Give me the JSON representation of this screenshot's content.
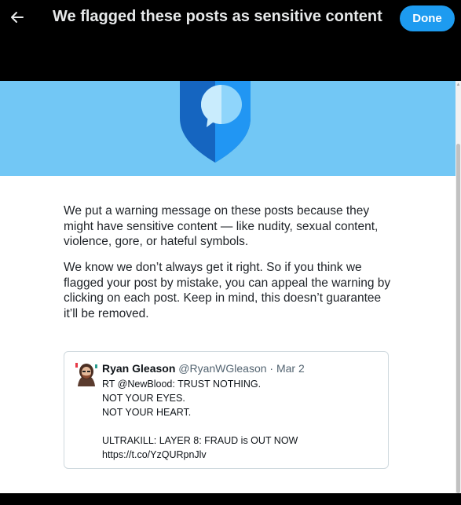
{
  "header": {
    "title": "We flagged these posts as sensitive content",
    "done_label": "Done",
    "back_icon": "arrow-left-icon"
  },
  "banner": {
    "background": "#72c7f5",
    "icon": "shield-chat-icon"
  },
  "explanation": {
    "paragraph1": "We put a warning message on these posts because they might have sensitive content — like nudity, sexual content, violence, gore, or hateful symbols.",
    "paragraph2": "We know we don’t always get it right. So if you think we flagged your post by mistake, you can appeal the warning by clicking on each post. Keep in mind, this doesn’t guarantee it’ll be removed."
  },
  "post": {
    "author": "Ryan Gleason",
    "handle": "@RyanWGleason",
    "separator": "·",
    "date": "Mar 2",
    "text": "RT @NewBlood: TRUST NOTHING.\nNOT YOUR EYES.\nNOT YOUR HEART.\n\nULTRAKILL: LAYER 8: FRAUD is OUT NOW\nhttps://t.co/YzQURpnJlv"
  },
  "colors": {
    "accent": "#1d9bf0",
    "shield_dark": "#1565c0",
    "shield_light": "#2196f3"
  }
}
